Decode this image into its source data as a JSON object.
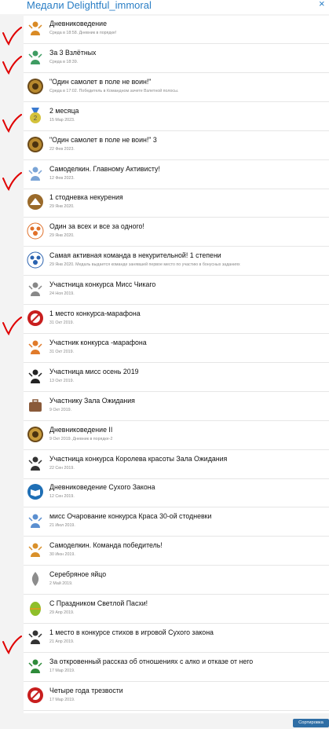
{
  "window": {
    "title": "Медали Delightful_immoral",
    "close_glyph": "×"
  },
  "medals": [
    {
      "title": "Дневниковедение",
      "desc": "Среда в 18:58. Дневник в порядке!",
      "icon": "book-medal-icon",
      "color": "#d98a25"
    },
    {
      "title": "За 3 Взлётных",
      "desc": "Среда в 18:39.",
      "icon": "airplane-figure-icon",
      "color": "#3e9c62"
    },
    {
      "title": "\"Один самолет в поле не воин!\"",
      "desc": "Среда в 17:02. Победитель в Командном зачете Взлетной полосы.",
      "icon": "gold-coin-medal-icon",
      "color": "#b8892e"
    },
    {
      "title": "2 месяца",
      "desc": "15 Мар 2023.",
      "icon": "ribbon-medal-2-icon",
      "color": "#d4c23b"
    },
    {
      "title": "\"Один самолет в поле не воин!\" 3",
      "desc": "22 Фев 2023.",
      "icon": "gold-coin-medal-icon",
      "color": "#b8892e"
    },
    {
      "title": "Самоделкин. Главному Активисту!",
      "desc": "12 Фев 2023.",
      "icon": "activist-figure-icon",
      "color": "#7aa4d6"
    },
    {
      "title": "1 стодневка некурения",
      "desc": "29 Янв 2020.",
      "icon": "mountain-medal-icon",
      "color": "#9a6a2a"
    },
    {
      "title": "Один за всех и все за одного!",
      "desc": "29 Янв 2020.",
      "icon": "team-circle-icon",
      "color": "#e0702a"
    },
    {
      "title": "Самая активная команда в некурительной! 1 степени",
      "desc": "29 Янв 2020. Медаль выдается команде занявшей первое место по участию в бонусных заданиях",
      "icon": "people-group-icon",
      "color": "#2b63b0"
    },
    {
      "title": "Участница конкурса Мисс Чикаго",
      "desc": "24 Ноя 2019.",
      "icon": "silhouette-icon",
      "color": "#888888"
    },
    {
      "title": "1 место конкурса-марафона",
      "desc": "31 Окт 2019.",
      "icon": "red-trophy-icon",
      "color": "#c81e1e"
    },
    {
      "title": "Участник конкурса -марафона",
      "desc": "31 Окт 2019.",
      "icon": "runner-figure-icon",
      "color": "#e07a2a"
    },
    {
      "title": "Участница мисс осень 2019",
      "desc": "13 Окт 2019.",
      "icon": "lady-silhouette-icon",
      "color": "#222222"
    },
    {
      "title": "Участнику Зала Ожидания",
      "desc": "9 Окт 2019.",
      "icon": "suitcase-icon",
      "color": "#8a5a3a"
    },
    {
      "title": "Дневниковедение II",
      "desc": "9 Окт 2019. Дневник в порядке-2",
      "icon": "owl-medal-icon",
      "color": "#c89a3a"
    },
    {
      "title": "Участница конкурса Королева красоты Зала Ожидания",
      "desc": "22 Сен 2019.",
      "icon": "dancer-silhouette-icon",
      "color": "#333333"
    },
    {
      "title": "Дневниковедение Сухого Закона",
      "desc": "12 Сен 2019.",
      "icon": "open-book-icon",
      "color": "#1f6fb5"
    },
    {
      "title": "мисс Очарование конкурса Краса 30-ой стодневки",
      "desc": "21 Июл 2019.",
      "icon": "girl-figure-icon",
      "color": "#5b8fd0"
    },
    {
      "title": "Самоделкин. Команда победитель!",
      "desc": "30 Июн 2019.",
      "icon": "team-figure-icon",
      "color": "#d9902a"
    },
    {
      "title": "Серебряное яйцо",
      "desc": "2 Май 2019.",
      "icon": "silver-flame-icon",
      "color": "#8c8c8c"
    },
    {
      "title": "С Праздником Светлой Пасхи!",
      "desc": "29 Апр 2019.",
      "icon": "easter-egg-icon",
      "color": "#8fbf2a"
    },
    {
      "title": "1 место в конкурсе стихов в игровой Сухого закона",
      "desc": "21 Апр 2019.",
      "icon": "quill-icon",
      "color": "#333333"
    },
    {
      "title": "За откровенный рассказ об отношениях с алко и отказе от него",
      "desc": "17 Мар 2019.",
      "icon": "green-figure-icon",
      "color": "#2e8b3a"
    },
    {
      "title": "Четыре года трезвости",
      "desc": "17 Мар 2019.",
      "icon": "no-alcohol-icon",
      "color": "#c81e1e"
    }
  ],
  "checkmarks": {
    "color": "#e00000",
    "rows": [
      0,
      1,
      3,
      5,
      10,
      21
    ]
  },
  "footer": {
    "sort_label": "Сортировка"
  }
}
